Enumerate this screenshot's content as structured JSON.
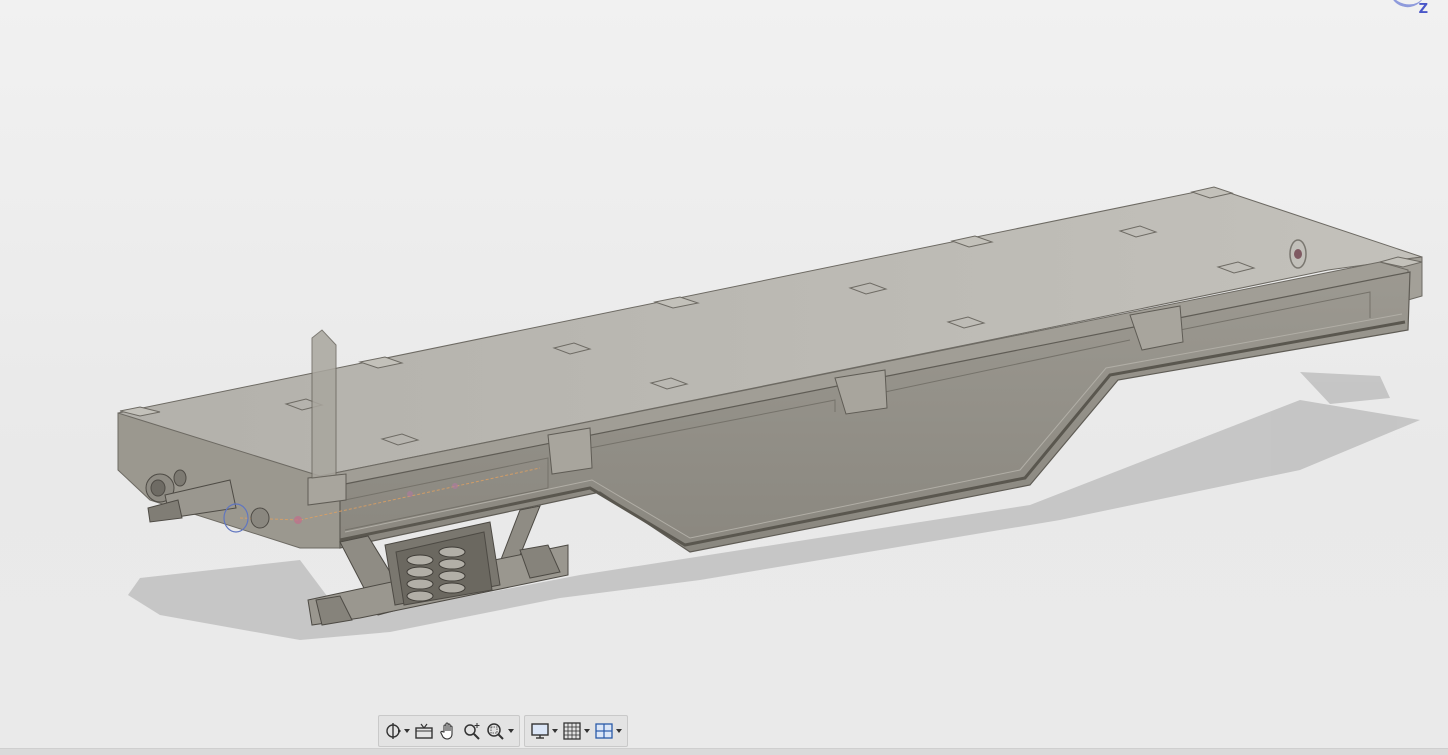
{
  "viewcube": {
    "axis_label": "Z"
  },
  "toolbar": {
    "groups": [
      {
        "name": "navigation",
        "tools": [
          "orbit-icon",
          "look-at-icon",
          "pan-icon",
          "zoom-icon",
          "fit-icon"
        ]
      },
      {
        "name": "display",
        "tools": [
          "display-settings-icon",
          "grid-snaps-icon",
          "viewports-icon"
        ]
      }
    ]
  },
  "colors": {
    "background": "#ececec",
    "model_top": "#b9b7b1",
    "model_side": "#96938b",
    "model_panel": "#8b8880",
    "shadow": "#b8b8b8",
    "sketch_line": "#e0a060",
    "axis_blue": "#4a57c8"
  }
}
